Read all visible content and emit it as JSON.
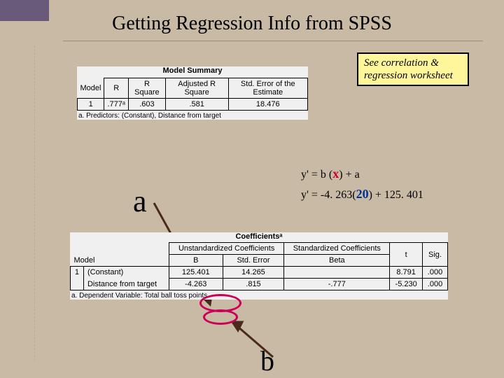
{
  "title": "Getting Regression Info from SPSS",
  "callout": "See correlation & regression worksheet",
  "summary": {
    "title": "Model Summary",
    "headers": {
      "model": "Model",
      "r": "R",
      "rsq": "R Square",
      "adjrsq": "Adjusted R Square",
      "stderr": "Std. Error of the Estimate"
    },
    "row": {
      "model": "1",
      "r": ".777ᵃ",
      "rsq": ".603",
      "adjrsq": ".581",
      "stderr": "18.476"
    },
    "footnote": "a. Predictors: (Constant), Distance from target"
  },
  "equation": {
    "line1": {
      "pre": "y' =   b   (",
      "x": "x",
      "mid": ")         +        a"
    },
    "line2": {
      "pre": "y' = -4. 263(",
      "num": "20",
      "post": ")  + 125. 401"
    }
  },
  "labels": {
    "a": "a",
    "b": "b"
  },
  "coef": {
    "title": "Coefficientsᵃ",
    "headers": {
      "model": "Model",
      "unstd": "Unstandardized Coefficients",
      "std": "Standardized Coefficients",
      "b": "B",
      "se": "Std. Error",
      "beta": "Beta",
      "t": "t",
      "sig": "Sig."
    },
    "rows": [
      {
        "model": "1",
        "name": "(Constant)",
        "b": "125.401",
        "se": "14.265",
        "beta": "",
        "t": "8.791",
        "sig": ".000"
      },
      {
        "model": "",
        "name": "Distance from target",
        "b": "-4.263",
        "se": ".815",
        "beta": "-.777",
        "t": "-5.230",
        "sig": ".000"
      }
    ],
    "footnote": "a. Dependent Variable: Total ball toss points"
  }
}
